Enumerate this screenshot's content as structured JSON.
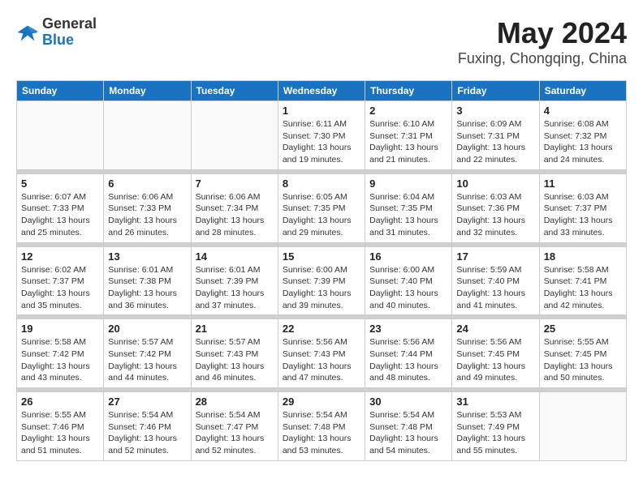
{
  "header": {
    "logo_general": "General",
    "logo_blue": "Blue",
    "month_title": "May 2024",
    "location": "Fuxing, Chongqing, China"
  },
  "weekdays": [
    "Sunday",
    "Monday",
    "Tuesday",
    "Wednesday",
    "Thursday",
    "Friday",
    "Saturday"
  ],
  "weeks": [
    [
      {
        "day": "",
        "info": ""
      },
      {
        "day": "",
        "info": ""
      },
      {
        "day": "",
        "info": ""
      },
      {
        "day": "1",
        "info": "Sunrise: 6:11 AM\nSunset: 7:30 PM\nDaylight: 13 hours\nand 19 minutes."
      },
      {
        "day": "2",
        "info": "Sunrise: 6:10 AM\nSunset: 7:31 PM\nDaylight: 13 hours\nand 21 minutes."
      },
      {
        "day": "3",
        "info": "Sunrise: 6:09 AM\nSunset: 7:31 PM\nDaylight: 13 hours\nand 22 minutes."
      },
      {
        "day": "4",
        "info": "Sunrise: 6:08 AM\nSunset: 7:32 PM\nDaylight: 13 hours\nand 24 minutes."
      }
    ],
    [
      {
        "day": "5",
        "info": "Sunrise: 6:07 AM\nSunset: 7:33 PM\nDaylight: 13 hours\nand 25 minutes."
      },
      {
        "day": "6",
        "info": "Sunrise: 6:06 AM\nSunset: 7:33 PM\nDaylight: 13 hours\nand 26 minutes."
      },
      {
        "day": "7",
        "info": "Sunrise: 6:06 AM\nSunset: 7:34 PM\nDaylight: 13 hours\nand 28 minutes."
      },
      {
        "day": "8",
        "info": "Sunrise: 6:05 AM\nSunset: 7:35 PM\nDaylight: 13 hours\nand 29 minutes."
      },
      {
        "day": "9",
        "info": "Sunrise: 6:04 AM\nSunset: 7:35 PM\nDaylight: 13 hours\nand 31 minutes."
      },
      {
        "day": "10",
        "info": "Sunrise: 6:03 AM\nSunset: 7:36 PM\nDaylight: 13 hours\nand 32 minutes."
      },
      {
        "day": "11",
        "info": "Sunrise: 6:03 AM\nSunset: 7:37 PM\nDaylight: 13 hours\nand 33 minutes."
      }
    ],
    [
      {
        "day": "12",
        "info": "Sunrise: 6:02 AM\nSunset: 7:37 PM\nDaylight: 13 hours\nand 35 minutes."
      },
      {
        "day": "13",
        "info": "Sunrise: 6:01 AM\nSunset: 7:38 PM\nDaylight: 13 hours\nand 36 minutes."
      },
      {
        "day": "14",
        "info": "Sunrise: 6:01 AM\nSunset: 7:39 PM\nDaylight: 13 hours\nand 37 minutes."
      },
      {
        "day": "15",
        "info": "Sunrise: 6:00 AM\nSunset: 7:39 PM\nDaylight: 13 hours\nand 39 minutes."
      },
      {
        "day": "16",
        "info": "Sunrise: 6:00 AM\nSunset: 7:40 PM\nDaylight: 13 hours\nand 40 minutes."
      },
      {
        "day": "17",
        "info": "Sunrise: 5:59 AM\nSunset: 7:40 PM\nDaylight: 13 hours\nand 41 minutes."
      },
      {
        "day": "18",
        "info": "Sunrise: 5:58 AM\nSunset: 7:41 PM\nDaylight: 13 hours\nand 42 minutes."
      }
    ],
    [
      {
        "day": "19",
        "info": "Sunrise: 5:58 AM\nSunset: 7:42 PM\nDaylight: 13 hours\nand 43 minutes."
      },
      {
        "day": "20",
        "info": "Sunrise: 5:57 AM\nSunset: 7:42 PM\nDaylight: 13 hours\nand 44 minutes."
      },
      {
        "day": "21",
        "info": "Sunrise: 5:57 AM\nSunset: 7:43 PM\nDaylight: 13 hours\nand 46 minutes."
      },
      {
        "day": "22",
        "info": "Sunrise: 5:56 AM\nSunset: 7:43 PM\nDaylight: 13 hours\nand 47 minutes."
      },
      {
        "day": "23",
        "info": "Sunrise: 5:56 AM\nSunset: 7:44 PM\nDaylight: 13 hours\nand 48 minutes."
      },
      {
        "day": "24",
        "info": "Sunrise: 5:56 AM\nSunset: 7:45 PM\nDaylight: 13 hours\nand 49 minutes."
      },
      {
        "day": "25",
        "info": "Sunrise: 5:55 AM\nSunset: 7:45 PM\nDaylight: 13 hours\nand 50 minutes."
      }
    ],
    [
      {
        "day": "26",
        "info": "Sunrise: 5:55 AM\nSunset: 7:46 PM\nDaylight: 13 hours\nand 51 minutes."
      },
      {
        "day": "27",
        "info": "Sunrise: 5:54 AM\nSunset: 7:46 PM\nDaylight: 13 hours\nand 52 minutes."
      },
      {
        "day": "28",
        "info": "Sunrise: 5:54 AM\nSunset: 7:47 PM\nDaylight: 13 hours\nand 52 minutes."
      },
      {
        "day": "29",
        "info": "Sunrise: 5:54 AM\nSunset: 7:48 PM\nDaylight: 13 hours\nand 53 minutes."
      },
      {
        "day": "30",
        "info": "Sunrise: 5:54 AM\nSunset: 7:48 PM\nDaylight: 13 hours\nand 54 minutes."
      },
      {
        "day": "31",
        "info": "Sunrise: 5:53 AM\nSunset: 7:49 PM\nDaylight: 13 hours\nand 55 minutes."
      },
      {
        "day": "",
        "info": ""
      }
    ]
  ]
}
